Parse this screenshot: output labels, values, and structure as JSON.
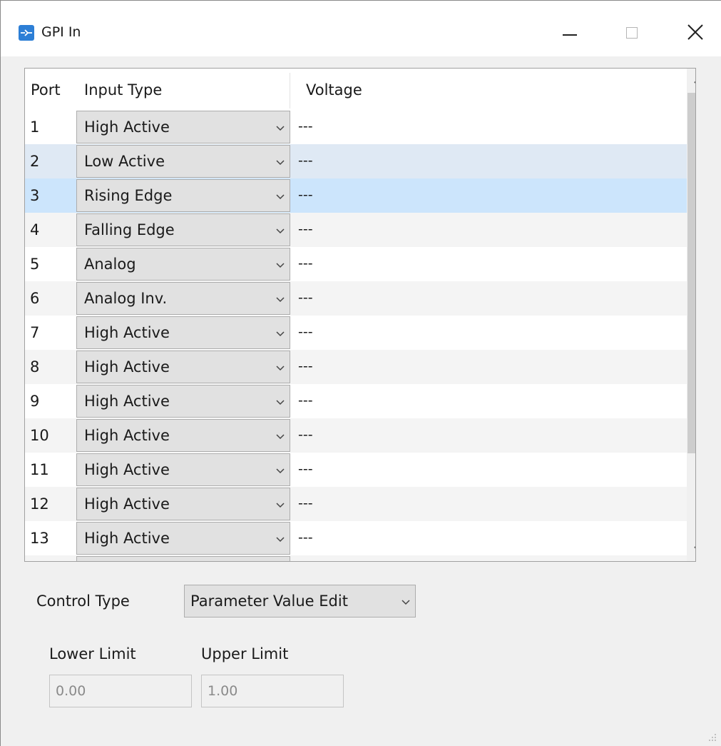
{
  "window": {
    "title": "GPI In",
    "icon": "gpi-in-app-icon",
    "buttons": [
      "minimize-icon",
      "maximize-icon",
      "close-icon"
    ]
  },
  "table": {
    "columns": [
      "Port",
      "Input Type",
      "Voltage"
    ],
    "rows": [
      {
        "port": "1",
        "input_type": "High Active",
        "voltage": "---"
      },
      {
        "port": "2",
        "input_type": "Low Active",
        "voltage": "---"
      },
      {
        "port": "3",
        "input_type": "Rising Edge",
        "voltage": "---"
      },
      {
        "port": "4",
        "input_type": "Falling Edge",
        "voltage": "---"
      },
      {
        "port": "5",
        "input_type": "Analog",
        "voltage": "---"
      },
      {
        "port": "6",
        "input_type": "Analog Inv.",
        "voltage": "---"
      },
      {
        "port": "7",
        "input_type": "High Active",
        "voltage": "---"
      },
      {
        "port": "8",
        "input_type": "High Active",
        "voltage": "---"
      },
      {
        "port": "9",
        "input_type": "High Active",
        "voltage": "---"
      },
      {
        "port": "10",
        "input_type": "High Active",
        "voltage": "---"
      },
      {
        "port": "11",
        "input_type": "High Active",
        "voltage": "---"
      },
      {
        "port": "12",
        "input_type": "High Active",
        "voltage": "---"
      },
      {
        "port": "13",
        "input_type": "High Active",
        "voltage": "---"
      }
    ],
    "hover_row": "2",
    "selected_row": "3"
  },
  "control": {
    "label": "Control Type",
    "value": "Parameter Value Edit"
  },
  "limits": {
    "lower_label": "Lower Limit",
    "lower_value": "0.00",
    "upper_label": "Upper Limit",
    "upper_value": "1.00"
  },
  "colors": {
    "accent": "#2d7fd6",
    "selected_row": "#cce5fc",
    "hover_row": "#dfe9f4",
    "combo_bg": "#e1e1e1"
  }
}
